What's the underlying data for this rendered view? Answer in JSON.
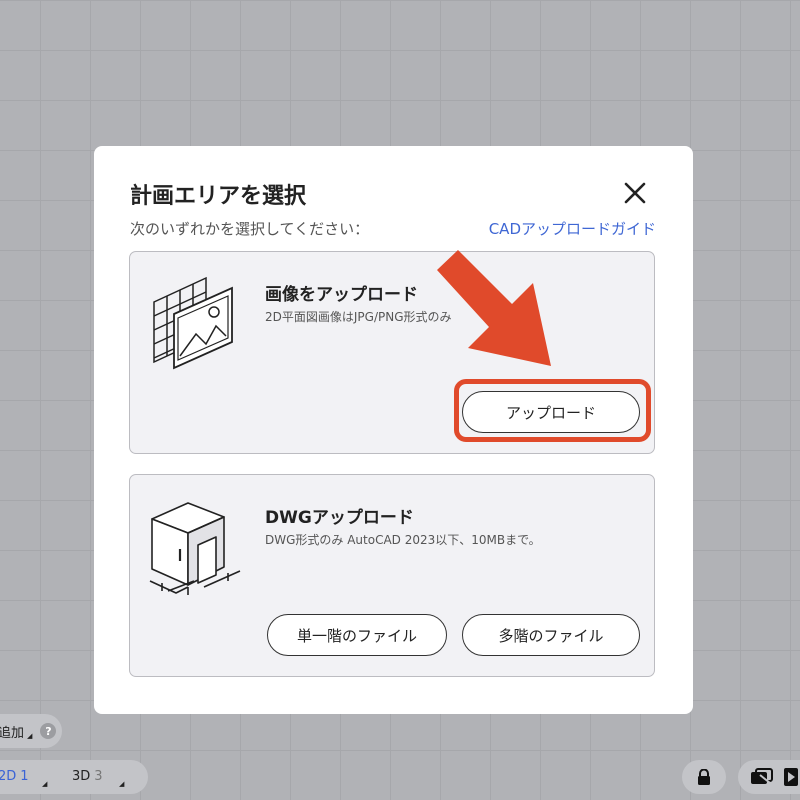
{
  "dialog": {
    "title": "計画エリアを選択",
    "subtitle": "次のいずれかを選択してください：",
    "guide_link": "CADアップロードガイド",
    "image_card": {
      "title": "画像をアップロード",
      "description": "2D平面図画像はJPG/PNG形式のみ",
      "upload_button": "アップロード"
    },
    "dwg_card": {
      "title": "DWGアップロード",
      "description": "DWG形式のみ AutoCAD 2023以下、10MBまで。",
      "single_floor_button": "単一階のファイル",
      "multi_floor_button": "多階のファイル"
    }
  },
  "toolbar": {
    "add_label": "追加",
    "help_symbol": "?",
    "tab_2d_label": "2D",
    "tab_2d_count": "1",
    "tab_3d_label": "3D",
    "tab_3d_count": "3"
  },
  "colors": {
    "accent_link": "#3f67d4",
    "annotation_red": "#e04a2b",
    "backdrop": "#b1b2b6"
  },
  "icons": [
    "close-icon",
    "image-upload-illustration",
    "dwg-building-illustration",
    "lock-icon",
    "view-toggle-icon",
    "play-icon",
    "caret-icon"
  ]
}
